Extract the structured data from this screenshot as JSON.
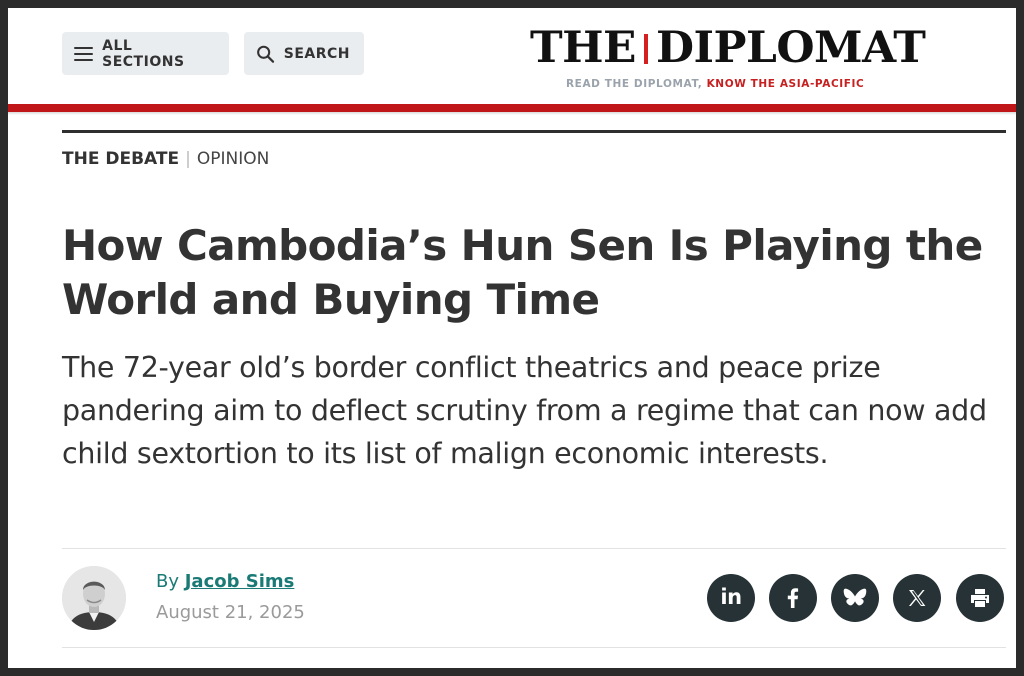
{
  "header": {
    "all_sections_label": "ALL SECTIONS",
    "search_label": "SEARCH",
    "logo": {
      "word1": "THE",
      "word2": "DIPLOMAT",
      "tagline_part1": "READ THE DIPLOMAT,",
      "tagline_part2": " KNOW THE ASIA-PACIFIC"
    }
  },
  "article": {
    "section": "THE DEBATE",
    "separator": "|",
    "type": "OPINION",
    "headline": "How Cambodia’s Hun Sen Is Playing the World and Buying Time",
    "dek": "The 72-year old’s border conflict theatrics and peace prize pandering aim to deflect scrutiny from a regime that can now add child sextortion to its list of malign economic interests.",
    "byline_prefix": "By ",
    "author": "Jacob Sims",
    "date": "August 21, 2025"
  },
  "share_icons": [
    "linkedin-icon",
    "facebook-icon",
    "bluesky-icon",
    "x-icon",
    "print-icon"
  ],
  "colors": {
    "brand_red": "#c0161a",
    "tagline_red": "#c62020",
    "author_link": "#1a7a75",
    "share_bg": "#263236",
    "text": "#333333"
  }
}
